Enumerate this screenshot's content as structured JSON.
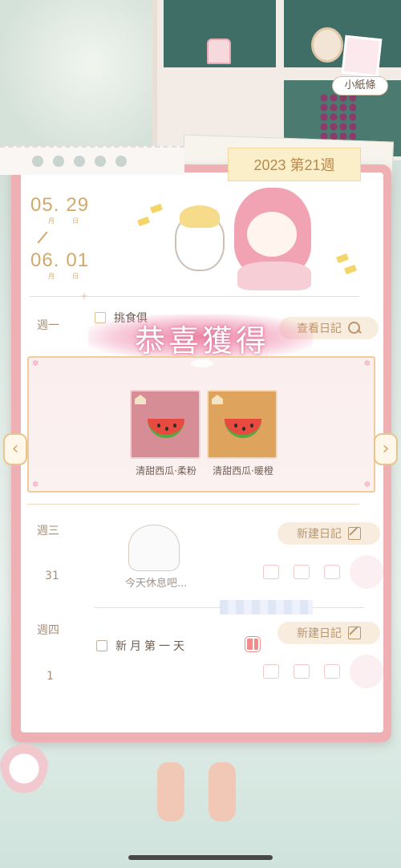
{
  "header": {
    "note_tag": "小紙條",
    "week_title": "2023 第21週"
  },
  "date_range": {
    "start_month": "05.",
    "start_day": "29",
    "end_month": "06.",
    "end_day": "01",
    "month_unit": "月",
    "day_unit": "日"
  },
  "days": [
    {
      "weekday": "週一",
      "task": "挑食俱",
      "task_checked": true,
      "button": "查看日記"
    },
    {
      "weekday": "週三",
      "day_number": "31",
      "rest_text": "今天休息吧...",
      "button": "新建日記"
    },
    {
      "weekday": "週四",
      "day_number": "1",
      "task": "新月第一天",
      "task_checked": false,
      "button": "新建日記"
    }
  ],
  "reward": {
    "title": "恭喜獲得",
    "items": [
      {
        "name": "清甜西瓜·柔粉",
        "color": "#d78d95"
      },
      {
        "name": "清甜西瓜·暖橙",
        "color": "#dea45e"
      }
    ],
    "prev_arrow": "‹",
    "next_arrow": "›"
  },
  "colors": {
    "journal_border": "#efb0b3",
    "accent_gold": "#d3a86b",
    "reward_title": "#ffffff",
    "reward_glow": "#e37fa0"
  }
}
